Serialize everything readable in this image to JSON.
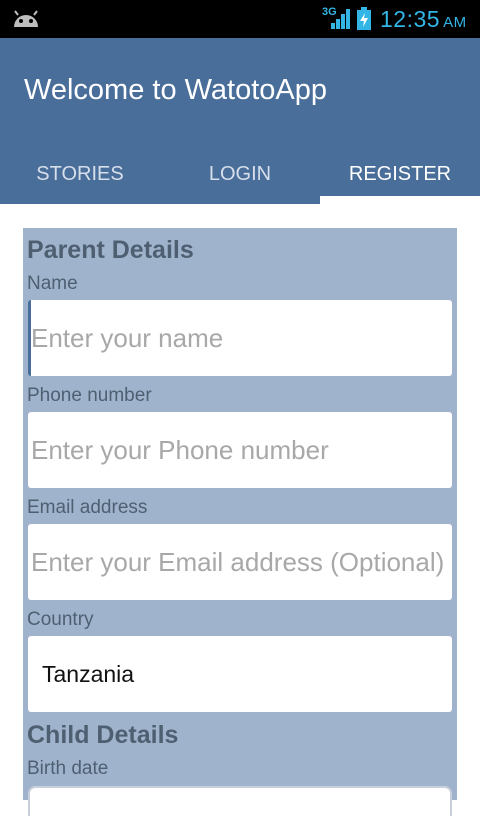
{
  "status_bar": {
    "network": "3G",
    "time": "12:35",
    "ampm": "AM",
    "icons": [
      "android-notification-icon",
      "signal-icon",
      "battery-charging-icon"
    ],
    "accent_color": "#33b5e5"
  },
  "action_bar": {
    "title": "Welcome to WatotoApp",
    "color": "#4a6e9a"
  },
  "tabs": [
    {
      "label": "STORIES",
      "selected": false
    },
    {
      "label": "LOGIN",
      "selected": false
    },
    {
      "label": "REGISTER",
      "selected": true
    }
  ],
  "form": {
    "parent_section_title": "Parent Details",
    "name": {
      "label": "Name",
      "placeholder": "Enter your name",
      "value": ""
    },
    "phone": {
      "label": "Phone number",
      "placeholder": "Enter your Phone number",
      "value": ""
    },
    "email": {
      "label": "Email address",
      "placeholder": "Enter your Email address (Optional)",
      "value": ""
    },
    "country": {
      "label": "Country",
      "selected": "Tanzania"
    },
    "child_section_title": "Child Details",
    "birth_date": {
      "label": "Birth date"
    }
  }
}
